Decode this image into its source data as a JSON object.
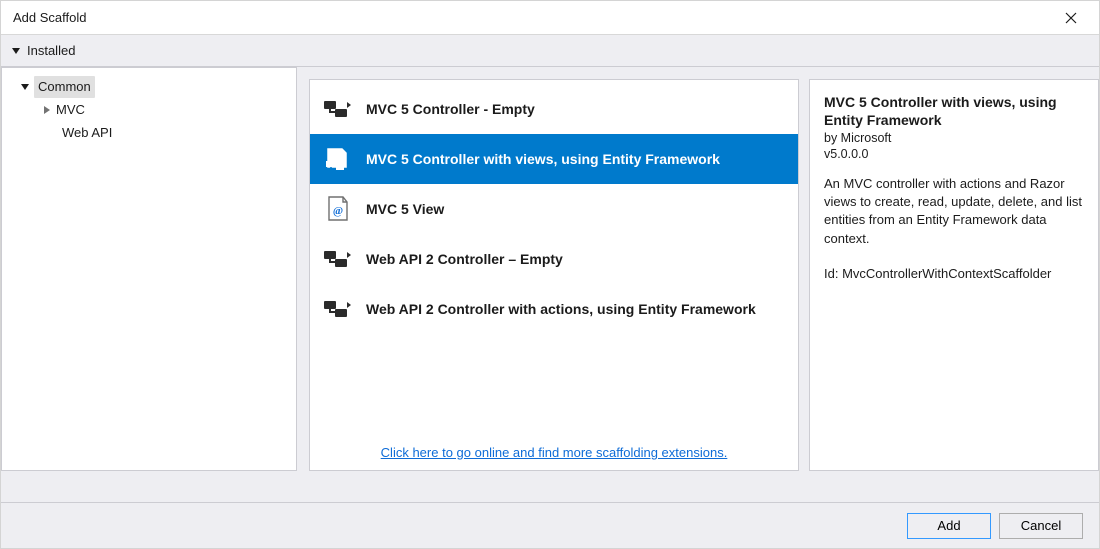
{
  "title": "Add Scaffold",
  "nav": {
    "label": "Installed"
  },
  "tree": {
    "root": {
      "label": "Common",
      "selected": true
    },
    "children": [
      {
        "label": "MVC",
        "hasChildren": true
      },
      {
        "label": "Web API",
        "hasChildren": false
      }
    ]
  },
  "scaffolds": [
    {
      "label": "MVC 5 Controller - Empty",
      "iconType": "controller",
      "selected": false
    },
    {
      "label": "MVC 5 Controller with views, using Entity Framework",
      "iconType": "controller-views",
      "selected": true
    },
    {
      "label": "MVC 5 View",
      "iconType": "view",
      "selected": false
    },
    {
      "label": "Web API 2 Controller – Empty",
      "iconType": "controller",
      "selected": false
    },
    {
      "label": "Web API 2 Controller with actions, using Entity Framework",
      "iconType": "controller",
      "selected": false
    }
  ],
  "online_link": "Click here to go online and find more scaffolding extensions.",
  "details": {
    "title": "MVC 5 Controller with views, using Entity Framework",
    "by": "by Microsoft",
    "version": "v5.0.0.0",
    "description": "An MVC controller with actions and Razor views to create, read, update, delete, and list entities from an Entity Framework data context.",
    "id_label": "Id:",
    "id_value": "MvcControllerWithContextScaffolder"
  },
  "footer": {
    "add": "Add",
    "cancel": "Cancel"
  }
}
